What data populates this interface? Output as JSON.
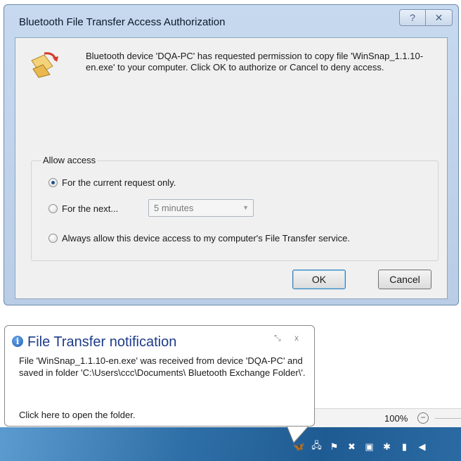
{
  "dialog": {
    "title": "Bluetooth File Transfer Access Authorization",
    "help_glyph": "?",
    "close_glyph": "✕",
    "message": "Bluetooth device 'DQA-PC' has requested permission to copy file 'WinSnap_1.1.10-en.exe' to your computer.  Click OK to authorize or Cancel to deny access.",
    "icon": "file-transfer-icon",
    "group_label": "Allow access",
    "options": [
      {
        "label": "For the current request only.",
        "checked": true
      },
      {
        "label": "For the next...",
        "checked": false
      },
      {
        "label": "Always allow this device access to my computer's File Transfer service.",
        "checked": false
      }
    ],
    "duration_value": "5 minutes",
    "ok_label": "OK",
    "cancel_label": "Cancel"
  },
  "notification": {
    "title": "File Transfer notification",
    "body": "File 'WinSnap_1.1.10-en.exe' was received from device 'DQA-PC' and saved in folder 'C:\\Users\\ccc\\Documents\\ Bluetooth Exchange Folder\\'.",
    "link": "Click here to open the folder.",
    "controls": "⤡ x"
  },
  "zoom": {
    "value": "100%",
    "minus": "−"
  },
  "tray_icons": [
    "bluetooth-transfer-icon",
    "network-icon",
    "action-center-flag-icon",
    "cancel-icon",
    "display-icon",
    "bluetooth-icon",
    "battery-icon",
    "volume-icon"
  ]
}
